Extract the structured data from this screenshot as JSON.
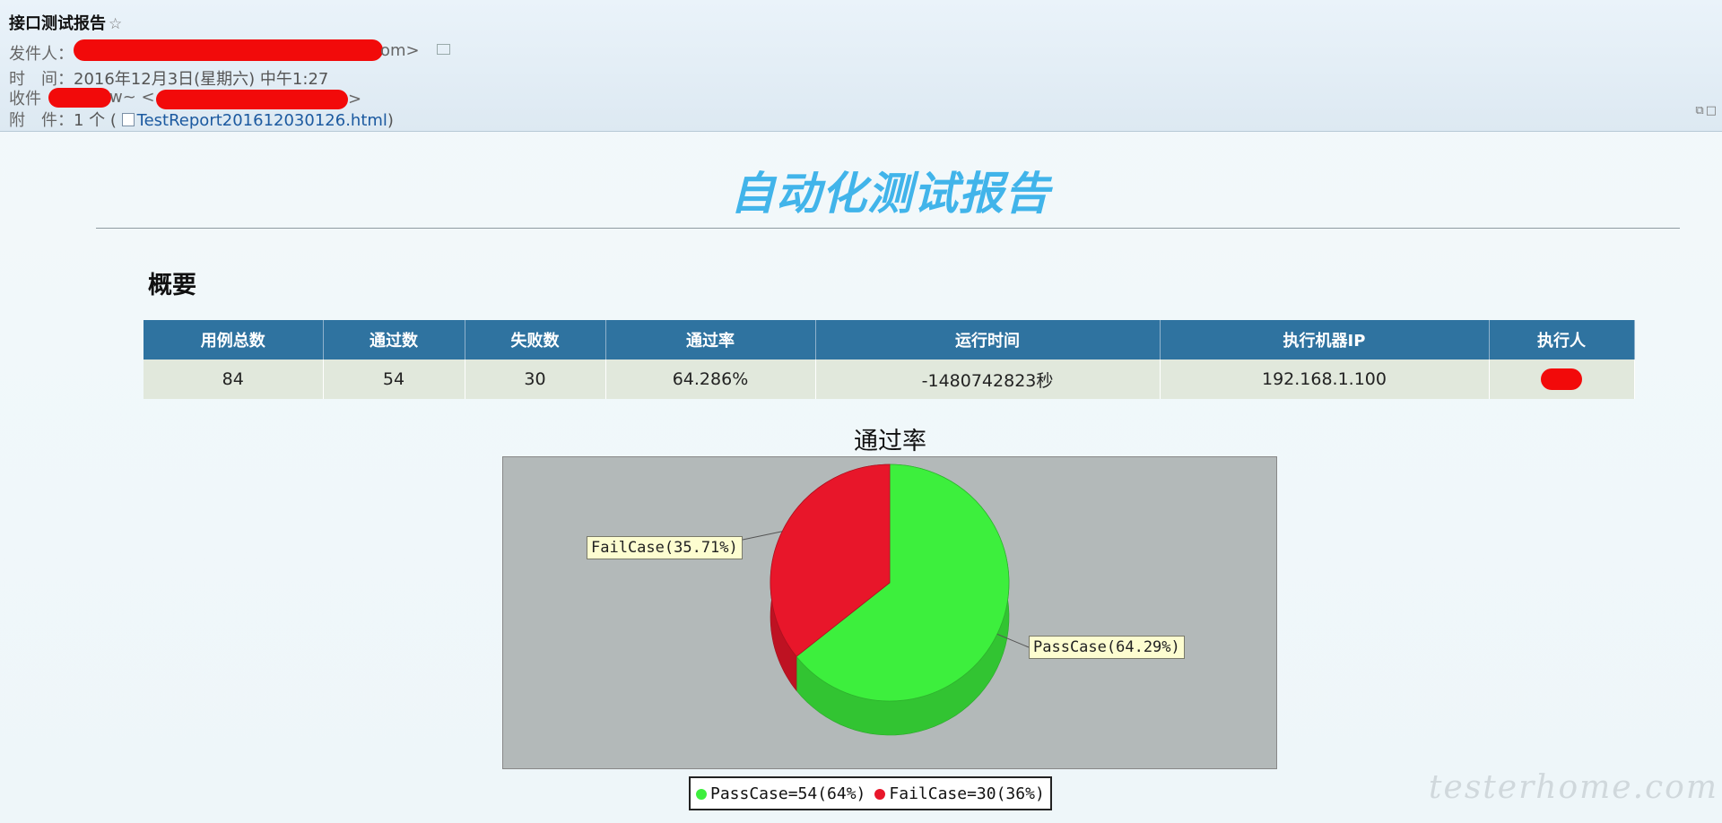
{
  "email": {
    "subject": "接口测试报告",
    "star_icon": "☆",
    "sender_label": "发件人：",
    "sender_tail": "om>",
    "time_label": "时　间：",
    "time_value": "2016年12月3日(星期六) 中午1:27",
    "recipient_label": "收件",
    "recipient_tail": "w~ <",
    "recipient_tail2": ">",
    "attachment_label": "附　件：",
    "attachment_count": "1 个 (",
    "attachment_file": "TestReport201612030126.html",
    "attachment_close": ")",
    "redact_color": "#f20a0a"
  },
  "report": {
    "title": "自动化测试报告",
    "section_title": "概要",
    "columns": [
      "用例总数",
      "通过数",
      "失败数",
      "通过率",
      "运行时间",
      "执行机器IP",
      "执行人"
    ],
    "row": {
      "total": "84",
      "passed": "54",
      "failed": "30",
      "pass_rate": "64.286%",
      "run_time": "-1480742823秒",
      "machine_ip": "192.168.1.100"
    },
    "header_color": "#2f73a0"
  },
  "chart_data": {
    "type": "pie",
    "title": "通过率",
    "slices": [
      {
        "name": "PassCase",
        "value": 54,
        "percent": 64.29,
        "color": "#3def3d"
      },
      {
        "name": "FailCase",
        "value": 30,
        "percent": 35.71,
        "color": "#e8162a"
      }
    ],
    "slice_labels": [
      "PassCase(64.29%)",
      "FailCase(35.71%)"
    ],
    "legend": [
      "PassCase=54(64%)",
      "FailCase=30(36%)"
    ],
    "legend_placement": "bottom"
  },
  "watermark": "testerhome.com"
}
